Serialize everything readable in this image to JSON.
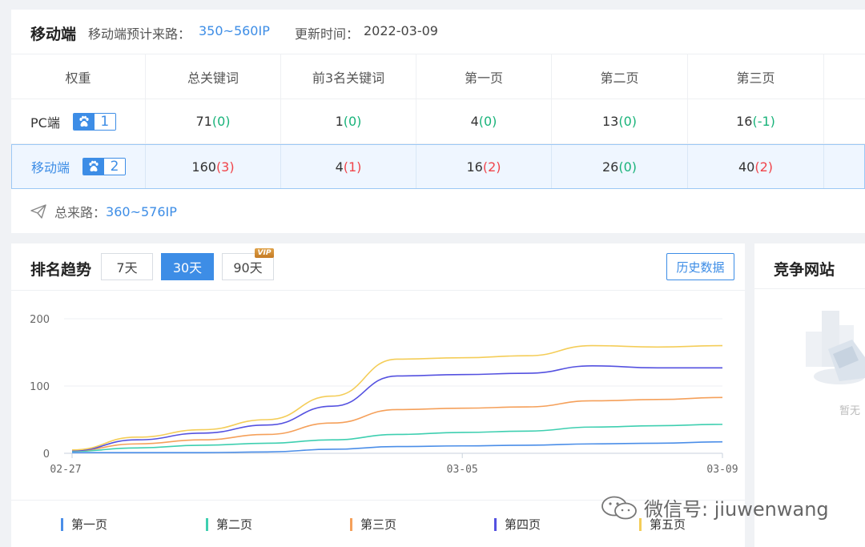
{
  "summary": {
    "title": "移动端",
    "estimate_label": "移动端预计来路：",
    "estimate_value": "350~560IP",
    "update_label": "更新时间：",
    "update_value": "2022-03-09",
    "columns": [
      "权重",
      "总关键词",
      "前3名关键词",
      "第一页",
      "第二页",
      "第三页"
    ],
    "rows": [
      {
        "name": "PC端",
        "weight": "1",
        "cells": [
          {
            "value": "71",
            "change": "(0)",
            "trend": "flat"
          },
          {
            "value": "1",
            "change": "(0)",
            "trend": "flat"
          },
          {
            "value": "4",
            "change": "(0)",
            "trend": "flat"
          },
          {
            "value": "13",
            "change": "(0)",
            "trend": "flat"
          },
          {
            "value": "16",
            "change": "(-1)",
            "trend": "down"
          }
        ]
      },
      {
        "name": "移动端",
        "weight": "2",
        "cells": [
          {
            "value": "160",
            "change": "(3)",
            "trend": "up"
          },
          {
            "value": "4",
            "change": "(1)",
            "trend": "up"
          },
          {
            "value": "16",
            "change": "(2)",
            "trend": "up"
          },
          {
            "value": "26",
            "change": "(0)",
            "trend": "flat"
          },
          {
            "value": "40",
            "change": "(2)",
            "trend": "up"
          }
        ]
      }
    ],
    "total_label": "总来路：",
    "total_value": "360~576IP"
  },
  "trend": {
    "title": "排名趋势",
    "tabs": [
      "7天",
      "30天",
      "90天"
    ],
    "active_tab": "30天",
    "vip_badge": "VIP",
    "history_button": "历史数据"
  },
  "competitors": {
    "title": "竞争网站",
    "empty_text": "暂无"
  },
  "watermark": "微信号: jiuwenwang",
  "colors": {
    "accent": "#3d8de6",
    "up": "#f0444a",
    "flat": "#19b37a",
    "series": [
      "#4b8ee8",
      "#3ecfb0",
      "#f5a05a",
      "#5451e0",
      "#f4cd58"
    ]
  },
  "chart_data": {
    "type": "line",
    "x": [
      "02-27",
      "02-28",
      "03-01",
      "03-02",
      "03-03",
      "03-04",
      "03-05",
      "03-06",
      "03-07",
      "03-08",
      "03-09"
    ],
    "xticks": [
      "02-27",
      "03-05",
      "03-09"
    ],
    "yticks": [
      0,
      100,
      200
    ],
    "ylim": [
      0,
      200
    ],
    "grid": true,
    "legend_position": "bottom",
    "series": [
      {
        "name": "第一页",
        "values": [
          1,
          1,
          1,
          2,
          6,
          10,
          11,
          12,
          14,
          15,
          17
        ]
      },
      {
        "name": "第二页",
        "values": [
          3,
          8,
          12,
          15,
          20,
          28,
          31,
          33,
          39,
          41,
          43
        ]
      },
      {
        "name": "第三页",
        "values": [
          4,
          14,
          20,
          28,
          45,
          65,
          67,
          69,
          78,
          80,
          83
        ]
      },
      {
        "name": "第四页",
        "values": [
          4,
          20,
          30,
          42,
          70,
          115,
          117,
          119,
          130,
          127,
          127
        ]
      },
      {
        "name": "第五页",
        "values": [
          5,
          24,
          35,
          50,
          85,
          140,
          142,
          145,
          160,
          158,
          160
        ]
      }
    ]
  }
}
